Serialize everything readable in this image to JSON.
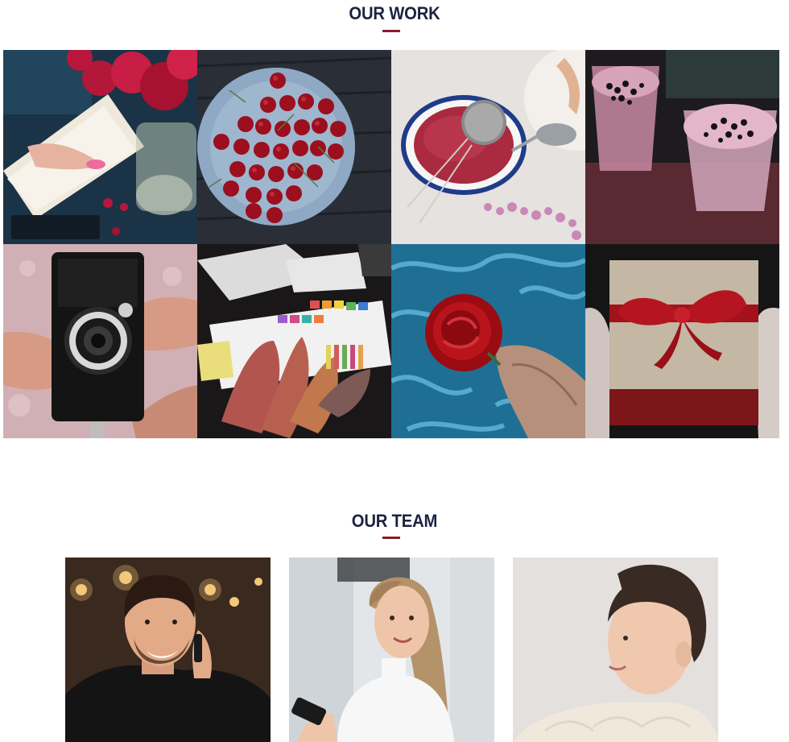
{
  "work": {
    "title": "OUR WORK",
    "accent_color": "#8a1c2b",
    "tiles": [
      {
        "subject": "flowers-notebook-photo"
      },
      {
        "subject": "cherries-plate-photo"
      },
      {
        "subject": "tea-strainer-photo"
      },
      {
        "subject": "berry-smoothies-photo"
      },
      {
        "subject": "vintage-camera-photo"
      },
      {
        "subject": "fabric-swatches-photo"
      },
      {
        "subject": "rose-water-photo"
      },
      {
        "subject": "gift-box-photo"
      }
    ]
  },
  "team": {
    "title": "OUR TEAM",
    "members": [
      {
        "subject": "man-on-phone-photo"
      },
      {
        "subject": "woman-with-phone-photo"
      },
      {
        "subject": "woman-in-sweater-photo"
      }
    ]
  },
  "colors": {
    "heading": "#1c2340",
    "accent": "#8a1c2b",
    "background": "#ffffff"
  }
}
